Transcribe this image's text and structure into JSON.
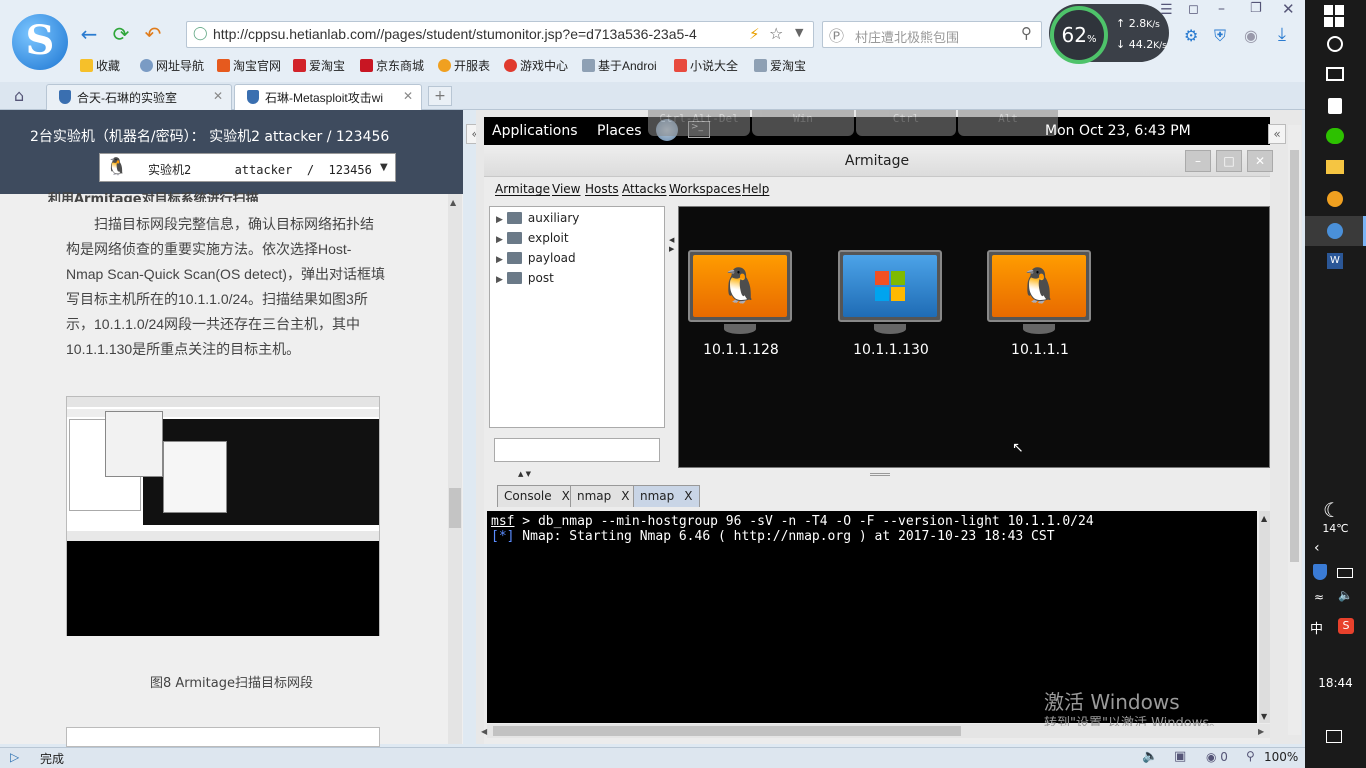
{
  "browser": {
    "url": "http://cppsu.hetianlab.com//pages/student/stumonitor.jsp?e=d713a536-23a5-4",
    "search_placeholder": "村庄遭北极熊包围",
    "perf": {
      "cpu": "62",
      "cpu_unit": "%",
      "up": "2.8",
      "down": "44.2",
      "unit": "K/s"
    },
    "bookmarks": [
      "收藏",
      "网址导航",
      "淘宝官网",
      "爱淘宝",
      "京东商城",
      "开服表",
      "游戏中心",
      "基于Androi",
      "小说大全",
      "爱淘宝"
    ],
    "tabs": [
      {
        "label": "合天-石琳的实验室"
      },
      {
        "label": "石琳-Metasploit攻击wi"
      }
    ],
    "status": "完成",
    "zoom": "100%",
    "download_count": "0"
  },
  "left": {
    "header": "2台实验机（机器名/密码）： 实验机2 attacker / 123456",
    "vm_select": "实验机2      attacker  /  123456",
    "cut_heading": "利用Armitage对目标系统进行扫描",
    "paragraph": "扫描目标网段完整信息，确认目标网络拓扑结构是网络侦查的重要实施方法。依次选择Host-Nmap Scan-Quick Scan(OS detect)，弹出对话框填写目标主机所在的10.1.1.0/24。扫描结果如图3所示，10.1.1.0/24网段一共还存在三台主机，其中10.1.1.130是所重点关注的目标主机。",
    "figure_caption": "图8 Armitage扫描目标网段"
  },
  "vm": {
    "keys": [
      "Ctrl-Alt-Del",
      "Win",
      "Ctrl",
      "Alt"
    ],
    "gnome": {
      "applications": "Applications",
      "places": "Places",
      "clock": "Mon Oct 23,  6:43 PM"
    },
    "window_title": "Armitage",
    "menu": [
      "Armitage",
      "View",
      "Hosts",
      "Attacks",
      "Workspaces",
      "Help"
    ],
    "tree": [
      "auxiliary",
      "exploit",
      "payload",
      "post"
    ],
    "hosts": [
      {
        "ip": "10.1.1.128",
        "os": "linux"
      },
      {
        "ip": "10.1.1.130",
        "os": "windows"
      },
      {
        "ip": "10.1.1.1",
        "os": "linux"
      }
    ],
    "console_tabs": [
      "Console",
      "nmap",
      "nmap"
    ],
    "console_lines": [
      "msf > db_nmap --min-hostgroup 96 -sV -n -T4 -O -F --version-light 10.1.1.0/24",
      "[*] Nmap: Starting Nmap 6.46 ( http://nmap.org ) at 2017-10-23 18:43 CST"
    ],
    "watermark": "激活 Windows",
    "watermark_sub": "转到\"设置\"以激活 Windows。"
  },
  "taskbar": {
    "temp": "14℃",
    "ime": "中",
    "clock": "18:44"
  }
}
